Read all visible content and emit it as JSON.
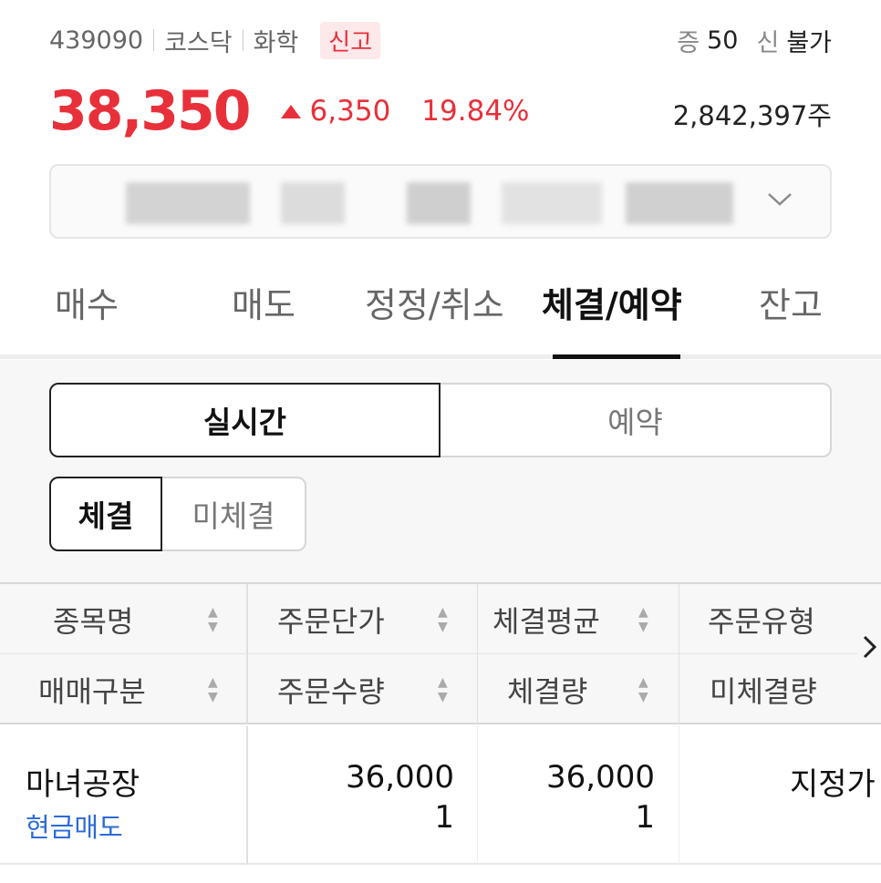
{
  "stock": {
    "code": "439090",
    "market": "코스닥",
    "sector": "화학",
    "badge": "신고",
    "margin_label": "증",
    "margin_value": "50",
    "credit_label": "신",
    "credit_value": "불가",
    "price": "38,350",
    "change": "6,350",
    "change_pct": "19.84%",
    "volume": "2,842,397주",
    "accent_color": "#e8303a"
  },
  "account": {
    "expand_icon": "chevron-down-icon"
  },
  "tabs": [
    {
      "label": "매수"
    },
    {
      "label": "매도"
    },
    {
      "label": "정정/취소"
    },
    {
      "label": "체결/예약",
      "active": true
    },
    {
      "label": "잔고"
    }
  ],
  "mode_toggle": {
    "realtime": "실시간",
    "reserve": "예약",
    "selected": "실시간"
  },
  "fill_toggle": {
    "filled": "체결",
    "unfilled": "미체결",
    "selected": "체결"
  },
  "table": {
    "header_row1": [
      "종목명",
      "주문단가",
      "체결평균",
      "주문유형"
    ],
    "header_row2": [
      "매매구분",
      "주문수량",
      "체결량",
      "미체결량"
    ],
    "rows": [
      {
        "name": "마녀공장",
        "trade_type": "현금매도",
        "order_price": "36,000",
        "order_qty": "1",
        "avg_fill": "36,000",
        "fill_qty": "1",
        "order_type": "지정가"
      }
    ],
    "more_icon": "chevron-right-icon"
  }
}
